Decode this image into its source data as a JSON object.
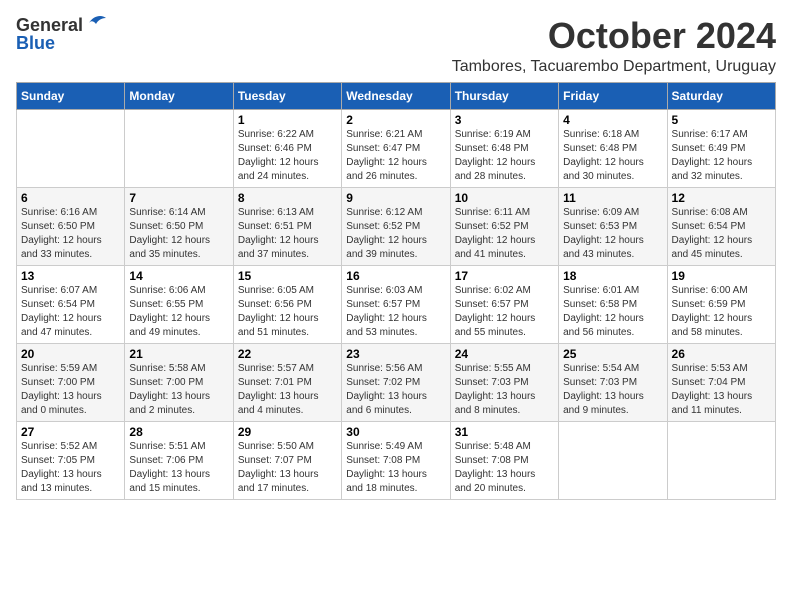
{
  "logo": {
    "general": "General",
    "blue": "Blue"
  },
  "header": {
    "month": "October 2024",
    "location": "Tambores, Tacuarembo Department, Uruguay"
  },
  "weekdays": [
    "Sunday",
    "Monday",
    "Tuesday",
    "Wednesday",
    "Thursday",
    "Friday",
    "Saturday"
  ],
  "weeks": [
    [
      {
        "day": null
      },
      {
        "day": null
      },
      {
        "day": "1",
        "sunrise": "Sunrise: 6:22 AM",
        "sunset": "Sunset: 6:46 PM",
        "daylight": "Daylight: 12 hours and 24 minutes."
      },
      {
        "day": "2",
        "sunrise": "Sunrise: 6:21 AM",
        "sunset": "Sunset: 6:47 PM",
        "daylight": "Daylight: 12 hours and 26 minutes."
      },
      {
        "day": "3",
        "sunrise": "Sunrise: 6:19 AM",
        "sunset": "Sunset: 6:48 PM",
        "daylight": "Daylight: 12 hours and 28 minutes."
      },
      {
        "day": "4",
        "sunrise": "Sunrise: 6:18 AM",
        "sunset": "Sunset: 6:48 PM",
        "daylight": "Daylight: 12 hours and 30 minutes."
      },
      {
        "day": "5",
        "sunrise": "Sunrise: 6:17 AM",
        "sunset": "Sunset: 6:49 PM",
        "daylight": "Daylight: 12 hours and 32 minutes."
      }
    ],
    [
      {
        "day": "6",
        "sunrise": "Sunrise: 6:16 AM",
        "sunset": "Sunset: 6:50 PM",
        "daylight": "Daylight: 12 hours and 33 minutes."
      },
      {
        "day": "7",
        "sunrise": "Sunrise: 6:14 AM",
        "sunset": "Sunset: 6:50 PM",
        "daylight": "Daylight: 12 hours and 35 minutes."
      },
      {
        "day": "8",
        "sunrise": "Sunrise: 6:13 AM",
        "sunset": "Sunset: 6:51 PM",
        "daylight": "Daylight: 12 hours and 37 minutes."
      },
      {
        "day": "9",
        "sunrise": "Sunrise: 6:12 AM",
        "sunset": "Sunset: 6:52 PM",
        "daylight": "Daylight: 12 hours and 39 minutes."
      },
      {
        "day": "10",
        "sunrise": "Sunrise: 6:11 AM",
        "sunset": "Sunset: 6:52 PM",
        "daylight": "Daylight: 12 hours and 41 minutes."
      },
      {
        "day": "11",
        "sunrise": "Sunrise: 6:09 AM",
        "sunset": "Sunset: 6:53 PM",
        "daylight": "Daylight: 12 hours and 43 minutes."
      },
      {
        "day": "12",
        "sunrise": "Sunrise: 6:08 AM",
        "sunset": "Sunset: 6:54 PM",
        "daylight": "Daylight: 12 hours and 45 minutes."
      }
    ],
    [
      {
        "day": "13",
        "sunrise": "Sunrise: 6:07 AM",
        "sunset": "Sunset: 6:54 PM",
        "daylight": "Daylight: 12 hours and 47 minutes."
      },
      {
        "day": "14",
        "sunrise": "Sunrise: 6:06 AM",
        "sunset": "Sunset: 6:55 PM",
        "daylight": "Daylight: 12 hours and 49 minutes."
      },
      {
        "day": "15",
        "sunrise": "Sunrise: 6:05 AM",
        "sunset": "Sunset: 6:56 PM",
        "daylight": "Daylight: 12 hours and 51 minutes."
      },
      {
        "day": "16",
        "sunrise": "Sunrise: 6:03 AM",
        "sunset": "Sunset: 6:57 PM",
        "daylight": "Daylight: 12 hours and 53 minutes."
      },
      {
        "day": "17",
        "sunrise": "Sunrise: 6:02 AM",
        "sunset": "Sunset: 6:57 PM",
        "daylight": "Daylight: 12 hours and 55 minutes."
      },
      {
        "day": "18",
        "sunrise": "Sunrise: 6:01 AM",
        "sunset": "Sunset: 6:58 PM",
        "daylight": "Daylight: 12 hours and 56 minutes."
      },
      {
        "day": "19",
        "sunrise": "Sunrise: 6:00 AM",
        "sunset": "Sunset: 6:59 PM",
        "daylight": "Daylight: 12 hours and 58 minutes."
      }
    ],
    [
      {
        "day": "20",
        "sunrise": "Sunrise: 5:59 AM",
        "sunset": "Sunset: 7:00 PM",
        "daylight": "Daylight: 13 hours and 0 minutes."
      },
      {
        "day": "21",
        "sunrise": "Sunrise: 5:58 AM",
        "sunset": "Sunset: 7:00 PM",
        "daylight": "Daylight: 13 hours and 2 minutes."
      },
      {
        "day": "22",
        "sunrise": "Sunrise: 5:57 AM",
        "sunset": "Sunset: 7:01 PM",
        "daylight": "Daylight: 13 hours and 4 minutes."
      },
      {
        "day": "23",
        "sunrise": "Sunrise: 5:56 AM",
        "sunset": "Sunset: 7:02 PM",
        "daylight": "Daylight: 13 hours and 6 minutes."
      },
      {
        "day": "24",
        "sunrise": "Sunrise: 5:55 AM",
        "sunset": "Sunset: 7:03 PM",
        "daylight": "Daylight: 13 hours and 8 minutes."
      },
      {
        "day": "25",
        "sunrise": "Sunrise: 5:54 AM",
        "sunset": "Sunset: 7:03 PM",
        "daylight": "Daylight: 13 hours and 9 minutes."
      },
      {
        "day": "26",
        "sunrise": "Sunrise: 5:53 AM",
        "sunset": "Sunset: 7:04 PM",
        "daylight": "Daylight: 13 hours and 11 minutes."
      }
    ],
    [
      {
        "day": "27",
        "sunrise": "Sunrise: 5:52 AM",
        "sunset": "Sunset: 7:05 PM",
        "daylight": "Daylight: 13 hours and 13 minutes."
      },
      {
        "day": "28",
        "sunrise": "Sunrise: 5:51 AM",
        "sunset": "Sunset: 7:06 PM",
        "daylight": "Daylight: 13 hours and 15 minutes."
      },
      {
        "day": "29",
        "sunrise": "Sunrise: 5:50 AM",
        "sunset": "Sunset: 7:07 PM",
        "daylight": "Daylight: 13 hours and 17 minutes."
      },
      {
        "day": "30",
        "sunrise": "Sunrise: 5:49 AM",
        "sunset": "Sunset: 7:08 PM",
        "daylight": "Daylight: 13 hours and 18 minutes."
      },
      {
        "day": "31",
        "sunrise": "Sunrise: 5:48 AM",
        "sunset": "Sunset: 7:08 PM",
        "daylight": "Daylight: 13 hours and 20 minutes."
      },
      {
        "day": null
      },
      {
        "day": null
      }
    ]
  ]
}
